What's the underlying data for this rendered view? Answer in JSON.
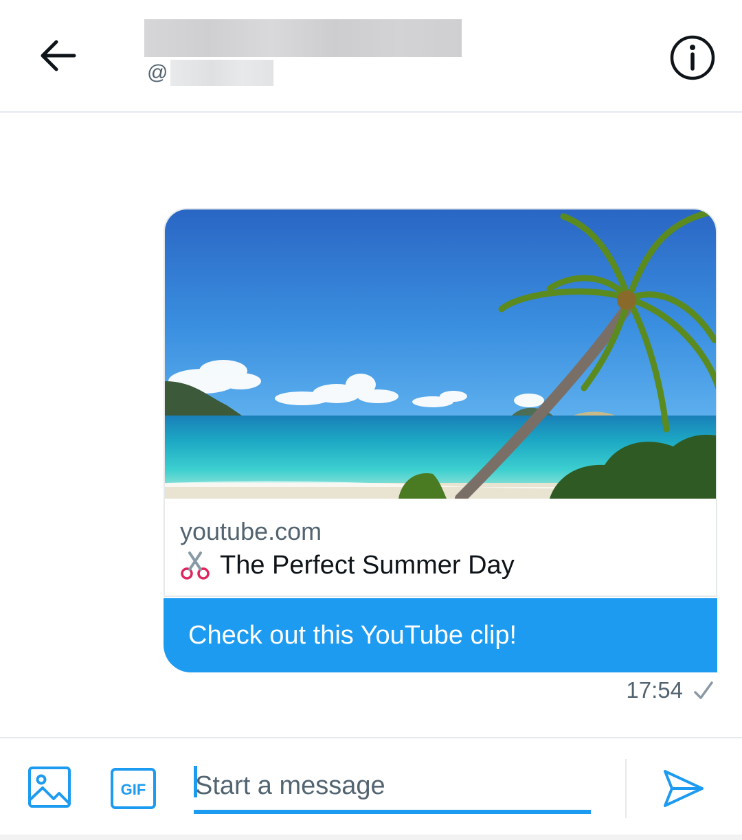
{
  "header": {
    "back_icon": "arrow-left-icon",
    "handle_prefix": "@",
    "info_icon": "info-circle-icon"
  },
  "message": {
    "link_card": {
      "domain": "youtube.com",
      "title_emoji": "scissors-icon",
      "title": "The Perfect Summer Day"
    },
    "text": "Check out this YouTube clip!",
    "time": "17:54",
    "status_icon": "check-icon"
  },
  "composer": {
    "placeholder": "Start a message",
    "media_icon": "image-icon",
    "gif_label": "GIF",
    "send_icon": "send-icon"
  },
  "colors": {
    "accent": "#1d9bf0",
    "text_secondary": "#536471",
    "border": "#e6e9ec"
  }
}
